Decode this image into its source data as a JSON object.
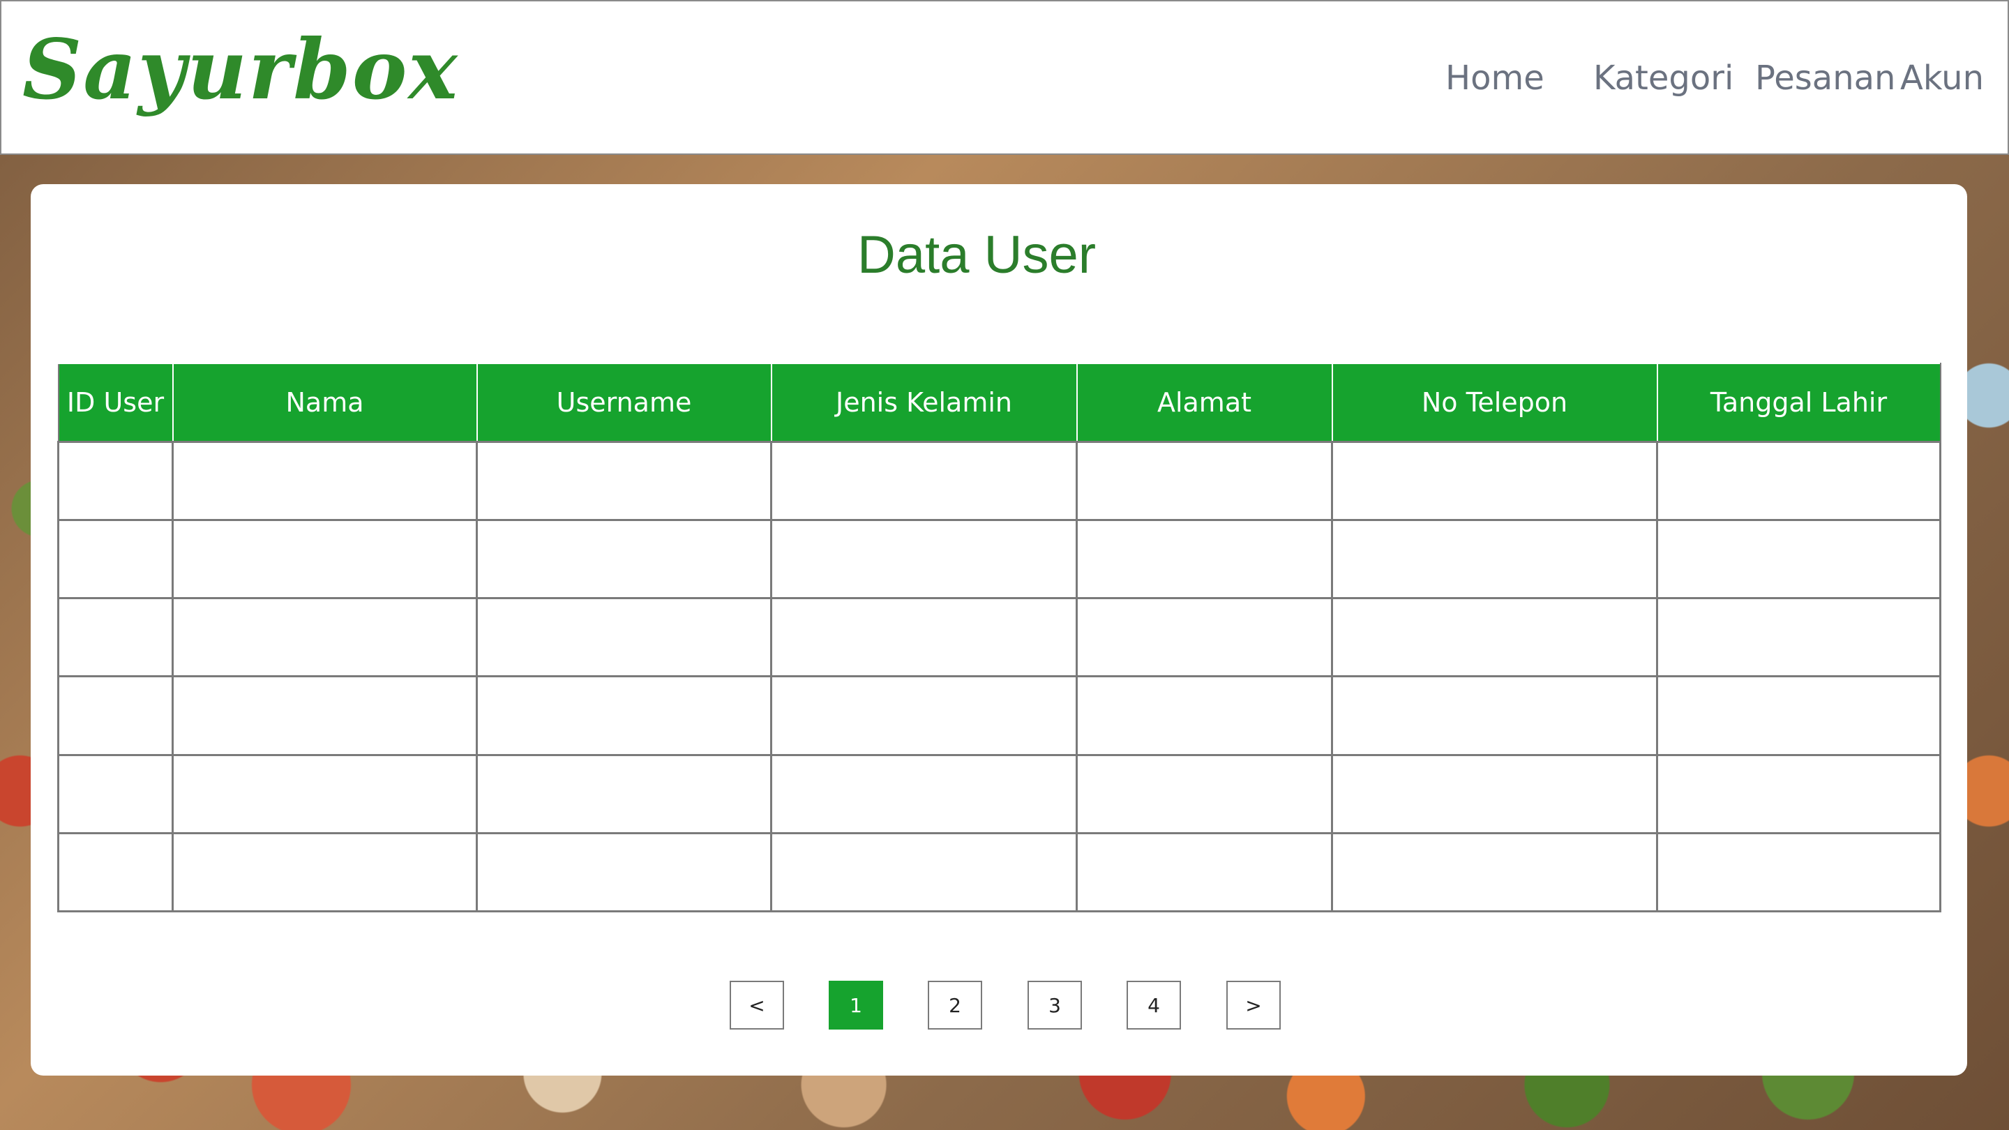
{
  "brand": {
    "logo_text": "Sayurbox",
    "accent_color": "#16a32e",
    "logo_color": "#2f8a2a"
  },
  "nav": {
    "items": [
      "Home",
      "Kategori",
      "Pesanan",
      "Akun"
    ]
  },
  "main": {
    "title": "Data User",
    "table": {
      "columns": [
        "ID User",
        "Nama",
        "Username",
        "Jenis Kelamin",
        "Alamat",
        "No Telepon",
        "Tanggal Lahir"
      ],
      "rows": [
        [
          "",
          "",
          "",
          "",
          "",
          "",
          ""
        ],
        [
          "",
          "",
          "",
          "",
          "",
          "",
          ""
        ],
        [
          "",
          "",
          "",
          "",
          "",
          "",
          ""
        ],
        [
          "",
          "",
          "",
          "",
          "",
          "",
          ""
        ],
        [
          "",
          "",
          "",
          "",
          "",
          "",
          ""
        ],
        [
          "",
          "",
          "",
          "",
          "",
          "",
          ""
        ]
      ]
    },
    "pagination": {
      "prev": "<",
      "pages": [
        "1",
        "2",
        "3",
        "4"
      ],
      "next": ">",
      "current": "1"
    }
  }
}
